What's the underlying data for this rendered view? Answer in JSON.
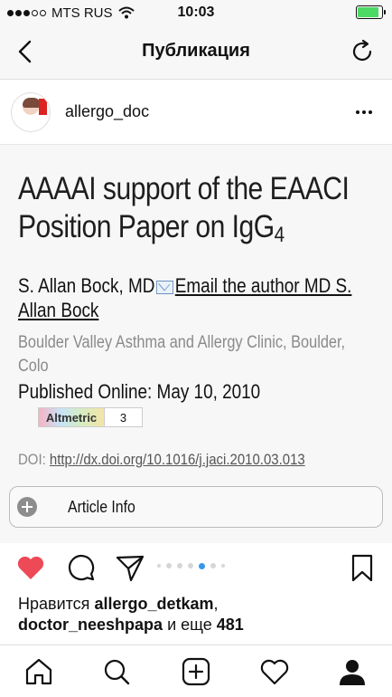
{
  "status_bar": {
    "carrier": "MTS RUS",
    "time": "10:03",
    "signal_bars_filled": 3,
    "signal_bars_total": 5,
    "battery_level": 0.9
  },
  "navbar": {
    "title": "Публикация"
  },
  "post": {
    "username": "allergo_doc"
  },
  "article": {
    "title_line1": "AAAAI support of the EAACI",
    "title_line2": "Position Paper on IgG",
    "title_subscript": "4",
    "author": "S. Allan Bock, MD",
    "email_link": "Email the author MD S. Allan Bock",
    "affiliation": "Boulder Valley Asthma and Allergy Clinic, Boulder, Colo",
    "published": "Published Online: May 10, 2010",
    "altmetric_label": "Altmetric",
    "altmetric_count": "3",
    "doi_label": "DOI:",
    "doi_link": "http://dx.doi.org/10.1016/j.jaci.2010.03.013",
    "article_info_label": "Article Info"
  },
  "carousel": {
    "total": 7,
    "active_index": 4
  },
  "likes": {
    "prefix": "Нравится",
    "user1": "allergo_detkam",
    "user2": "doctor_neeshpapa",
    "middle": "и еще",
    "count": "481"
  },
  "colors": {
    "like_red": "#ed4956",
    "carousel_active": "#3897f0",
    "battery_green": "#4cd964"
  },
  "icons": {
    "back": "chevron-left-icon",
    "reload": "reload-icon",
    "more": "more-dots-icon",
    "like": "heart-filled-icon",
    "comment": "comment-icon",
    "share": "send-icon",
    "save": "bookmark-icon",
    "home": "home-icon",
    "search": "search-icon",
    "add": "add-icon",
    "activity": "heart-outline-icon",
    "profile": "profile-icon"
  }
}
